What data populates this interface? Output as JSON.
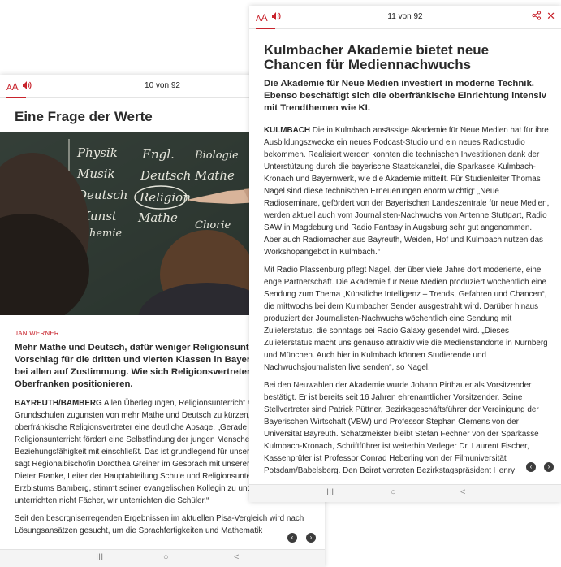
{
  "front": {
    "font_size_control": "AA",
    "page_counter": "11 von 92",
    "headline": "Kulmbacher Akademie bietet neue Chancen für Mediennachwuchs",
    "lead": "Die Akademie für Neue Medien investiert in moderne Technik. Ebenso beschäftigt sich die oberfränkische Einrichtung intensiv mit Trendthemen wie KI.",
    "dateline": "KULMBACH",
    "paragraphs": [
      "Die in Kulmbach ansässige Akademie für Neue Medien hat für ihre Ausbildungszwecke ein neues Podcast-Studio und ein neues Radiostudio bekommen. Realisiert werden konnten die technischen Investitionen dank der Unterstützung durch die bayerische Staatskanzlei, die Sparkasse Kulmbach-Kronach und Bayernwerk, wie die Akademie mitteilt. Für Studienleiter Thomas Nagel sind diese technischen Erneuerungen enorm wichtig: „Neue Radioseminare, gefördert von der Bayerischen Landeszentrale für neue Medien, werden aktuell auch vom Journalisten-Nachwuchs von Antenne Stuttgart, Radio SAW in Magdeburg und Radio Fantasy in Augsburg sehr gut angenommen. Aber auch Radiomacher aus Bayreuth, Weiden, Hof und Kulmbach nutzen das Workshopangebot in Kulmbach.“",
      "Mit Radio Plassenburg pflegt Nagel, der über viele Jahre dort moderierte, eine enge Partnerschaft. Die Akademie für Neue Medien produziert wöchentlich eine Sendung zum Thema „Künstliche Intelligenz – Trends, Gefahren und Chancen“, die mittwochs bei dem Kulmbacher Sender ausgestrahlt wird. Darüber hinaus produziert der Journalisten-Nachwuchs wöchentlich eine Sendung mit Zulieferstatus, die sonntags bei Radio Galaxy gesendet wird. „Dieses Zulieferstatus macht uns genauso attraktiv wie die Medienstandorte in Nürnberg und München. Auch hier in Kulmbach können Studierende und Nachwuchsjournalisten live senden“, so Nagel.",
      "Bei den Neuwahlen der Akademie wurde Johann Pirthauer als Vorsitzender bestätigt. Er ist bereits seit 16 Jahren ehrenamtlicher Vorsitzender. Seine Stellvertreter sind Patrick Püttner, Bezirksgeschäftsführer der Vereinigung der Bayerischen Wirtschaft (VBW) und Professor Stephan Clemens von der Universität Bayreuth. Schatzmeister bleibt Stefan Fechner von der Sparkasse Kulmbach-Kronach, Schriftführer ist weiterhin Verleger Dr. Laurent Fischer, Kassenprüfer ist Professor Conrad Heberling von der Filmuniversität Potsdam/Babelsberg. Den Beirat vertreten Bezirkstagspräsident Henry"
    ]
  },
  "back": {
    "font_size_control": "AA",
    "page_counter": "10 von 92",
    "headline": "Eine Frage der Werte",
    "author": "JAN WERNER",
    "lead": "Mehr Mathe und Deutsch, dafür weniger Religionsunterricht: Der Vorschlag für die dritten und vierten Klassen in Bayern stößt nicht bei allen auf Zustimmung. Wie sich Religionsvertreter in Oberfranken positionieren.",
    "dateline": "BAYREUTH/BAMBERG",
    "paragraphs": [
      "Allen Überlegungen, Religionsunterricht an bayerischen Grundschulen zugunsten von mehr Mathe und Deutsch zu kürzen, erteilen oberfränkische Religionsvertreter eine deutliche Absage. „Gerade der Religionsunterricht fördert eine Selbstfindung der jungen Menschen und zugleich die Beziehungsfähigkeit mit einschließt. Das ist grundlegend für unsere Demokratie“, sagt Regionalbischöfin Dorothea Greiner im Gespräch mit unserer Redaktion. Hans-Dieter Franke, Leiter der Hauptabteilung Schule und Religionsunterricht des Erzbistums Bamberg, stimmt seiner evangelischen Kollegin zu und fügt an: „Wir unterrichten nicht Fächer, wir unterrichten die Schüler.“",
      "Seit den besorgniserregenden Ergebnissen im aktuellen Pisa-Vergleich wird nach Lösungsansätzen gesucht, um die Sprachfertigkeiten und Mathematik"
    ],
    "photo_subjects": [
      "Physik",
      "Musik",
      "Deutsch",
      "Kunst",
      "Chemie",
      "Engl.",
      "Deutsch",
      "Religion",
      "Mathe",
      "Biologie",
      "Mathe",
      "Chorie"
    ]
  },
  "icons": {
    "audio": "speaker-icon",
    "share": "share-icon",
    "close": "close-icon",
    "prev": "chevron-left-icon",
    "next": "chevron-right-icon"
  },
  "navbar": {
    "recent": "III",
    "home": "○",
    "back": "<"
  },
  "colors": {
    "accent": "#c8232c",
    "board": "#2e3a33",
    "chalk": "#e8e8e0"
  }
}
